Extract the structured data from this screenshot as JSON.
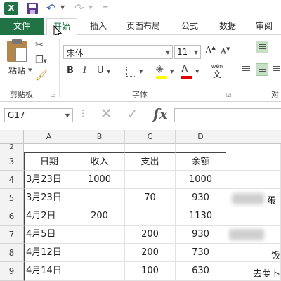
{
  "app": {
    "logo_text": "X"
  },
  "tabs": {
    "file": "文件",
    "home": "开始",
    "insert": "插入",
    "layout": "页面布局",
    "formulas": "公式",
    "data": "数据",
    "review": "审阅"
  },
  "ribbon": {
    "clipboard": {
      "paste_label": "粘贴",
      "group_label": "剪贴板"
    },
    "font": {
      "name": "宋体",
      "size": "11",
      "group_label": "字体",
      "bold": "B",
      "italic": "I",
      "underline": "U",
      "grow": "A",
      "shrink": "A",
      "font_color_glyph": "A",
      "phonetic_top": "wén",
      "phonetic_bottom": "文"
    },
    "alignment": {
      "group_label_partial": "对"
    }
  },
  "formula_bar": {
    "name_box": "G17",
    "fx": "fx"
  },
  "sheet": {
    "columns": [
      "A",
      "B",
      "C",
      "D"
    ],
    "rows": [
      {
        "num": "2",
        "a": "",
        "b": "",
        "c": "",
        "d": ""
      },
      {
        "num": "3",
        "a": "日期",
        "b": "收入",
        "c": "支出",
        "d": "余额"
      },
      {
        "num": "4",
        "a": "3月23日",
        "b": "1000",
        "c": "",
        "d": "1000"
      },
      {
        "num": "5",
        "a": "3月23日",
        "b": "",
        "c": "70",
        "d": "930"
      },
      {
        "num": "6",
        "a": "4月2日",
        "b": "200",
        "c": "",
        "d": "1130"
      },
      {
        "num": "7",
        "a": "4月5日",
        "b": "",
        "c": "200",
        "d": "930"
      },
      {
        "num": "8",
        "a": "4月12日",
        "b": "",
        "c": "200",
        "d": "730"
      },
      {
        "num": "9",
        "a": "4月14日",
        "b": "",
        "c": "100",
        "d": "630"
      }
    ],
    "overflow_text": {
      "row5": "蛋",
      "row8": "饭",
      "row9": "去萝卜"
    }
  },
  "colors": {
    "excel_green": "#217346",
    "fill_yellow": "#ffff00",
    "font_red": "#e00000"
  },
  "icons": [
    "excel-logo-icon",
    "save-icon",
    "undo-icon",
    "redo-icon",
    "cut-icon",
    "copy-icon",
    "format-painter-icon",
    "borders-icon",
    "fill-color-icon",
    "font-color-icon",
    "cancel-icon",
    "enter-icon",
    "function-icon"
  ]
}
